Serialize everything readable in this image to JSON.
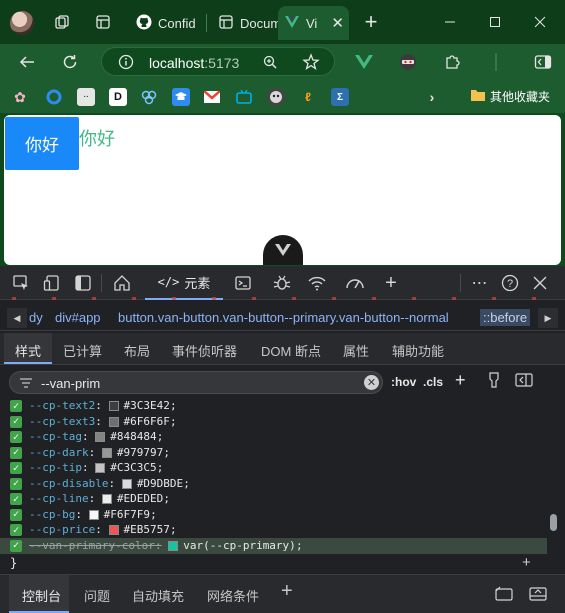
{
  "browser": {
    "tabs": [
      {
        "label": "Confid",
        "icon": "github-icon"
      },
      {
        "label": "Docum",
        "icon": "page-icon"
      },
      {
        "label": "Vi",
        "icon": "vite-icon",
        "active": true
      }
    ],
    "url": {
      "host": "localhost",
      "port": ":5173"
    },
    "bookmarks_folder": "其他收藏夹",
    "bookmark_icons": [
      "flower-icon",
      "blue-circle-icon",
      "bilibili-icon",
      "d-icon",
      "shield-icon",
      "graduation-icon",
      "gmail-icon",
      "tv-icon",
      "red-panda-icon",
      "leetcode-icon",
      "sigma-icon"
    ]
  },
  "page": {
    "button_label": "你好",
    "text": "你好"
  },
  "devtools": {
    "elements_tab": "元素",
    "breadcrumbs": [
      "dy",
      "div#app",
      "button.van-button.van-button--primary.van-button--normal",
      "::before"
    ],
    "subtabs": [
      "样式",
      "已计算",
      "布局",
      "事件侦听器",
      "DOM 断点",
      "属性",
      "辅助功能"
    ],
    "filter": {
      "value": "--van-prim",
      "hov": ":hov",
      "cls": ".cls"
    },
    "declarations": [
      {
        "prop": "--cp-text2",
        "value": "#3C3E42",
        "color": "#3C3E42"
      },
      {
        "prop": "--cp-text3",
        "value": "#6F6F6F",
        "color": "#6F6F6F"
      },
      {
        "prop": "--cp-tag",
        "value": "#848484",
        "color": "#848484"
      },
      {
        "prop": "--cp-dark",
        "value": "#979797",
        "color": "#979797"
      },
      {
        "prop": "--cp-tip",
        "value": "#C3C3C5",
        "color": "#C3C3C5"
      },
      {
        "prop": "--cp-disable",
        "value": "#D9DBDE",
        "color": "#D9DBDE"
      },
      {
        "prop": "--cp-line",
        "value": "#EDEDED",
        "color": "#EDEDED"
      },
      {
        "prop": "--cp-bg",
        "value": "#F6F7F9",
        "color": "#F6F7F9"
      },
      {
        "prop": "--cp-price",
        "value": "#EB5757",
        "color": "#EB5757"
      },
      {
        "prop": "--van-primary-color",
        "value": "var(--cp-primary)",
        "color": "#16C2A3",
        "overridden": true
      }
    ],
    "close_brace": "}",
    "drawer_tabs": [
      "控制台",
      "问题",
      "自动填充",
      "网络条件"
    ]
  },
  "colors": {
    "chrome_dark": "#0d3d19",
    "chrome": "#1d5c2e",
    "van_primary": "#1989fa",
    "vue_green": "#42b883"
  }
}
